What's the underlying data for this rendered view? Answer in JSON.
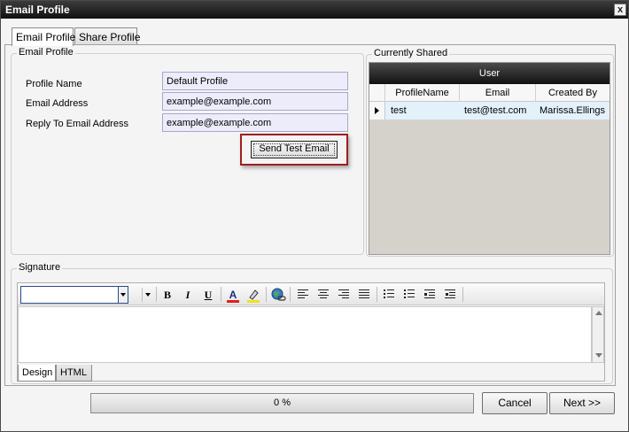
{
  "window": {
    "title": "Email Profile",
    "close_label": "x"
  },
  "tabs": [
    {
      "label": "Email Profile"
    },
    {
      "label": "Share Profile"
    }
  ],
  "profile_group": {
    "legend": "Email Profile",
    "fields": [
      {
        "label": "Profile Name",
        "value": "Default Profile"
      },
      {
        "label": "Email Address",
        "value": "example@example.com"
      },
      {
        "label": "Reply To Email Address",
        "value": "example@example.com"
      }
    ],
    "send_test_label": "Send Test Email"
  },
  "shared_group": {
    "legend": "Currently Shared",
    "group_header": "User",
    "columns": [
      "ProfileName",
      "Email",
      "Created By"
    ],
    "rows": [
      {
        "profile": "test",
        "email": "test@test.com",
        "created_by": "Marissa.Ellings"
      }
    ]
  },
  "signature": {
    "legend": "Signature",
    "font_value": "",
    "toolbar": {
      "bold": "B",
      "italic": "I",
      "underline": "U",
      "font_color": "A"
    },
    "colors": {
      "font_color_bar": "#e02020",
      "highlight_bar": "#f0e020"
    },
    "mode_tabs": [
      "Design",
      "HTML"
    ]
  },
  "footer": {
    "progress_text": "0 %",
    "progress_value": 0,
    "cancel_label": "Cancel",
    "next_label": "Next >>"
  }
}
